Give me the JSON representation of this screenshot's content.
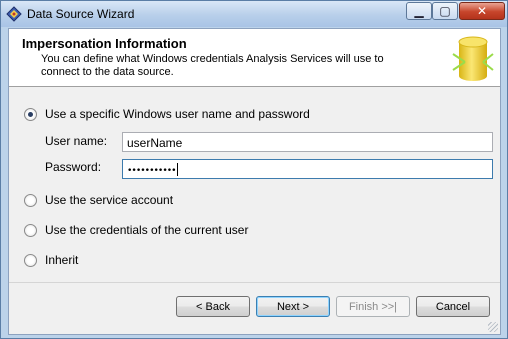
{
  "window": {
    "title": "Data Source Wizard",
    "icon": "wizard-diamond-icon",
    "controls": {
      "minimize": "▁",
      "maximize": "▢",
      "close": "✕"
    }
  },
  "header": {
    "title": "Impersonation Information",
    "description": "You can define what Windows credentials Analysis Services will use to connect to the data source.",
    "icon": "database-cylinder-icon"
  },
  "options": {
    "specific": {
      "label": "Use a specific Windows user name and password",
      "checked": true
    },
    "service": {
      "label": "Use the service account",
      "checked": false
    },
    "current": {
      "label": "Use the credentials of the current user",
      "checked": false
    },
    "inherit": {
      "label": "Inherit",
      "checked": false
    }
  },
  "fields": {
    "username": {
      "label": "User name:",
      "value": "userName"
    },
    "password": {
      "label": "Password:",
      "mask": "•••••••••••"
    }
  },
  "buttons": {
    "back": "< Back",
    "next": "Next >",
    "finish": "Finish >>|",
    "cancel": "Cancel"
  },
  "colors": {
    "titlebar": "#b8cfea",
    "close_button": "#c7452b",
    "dialog_bg": "#f0f0f0",
    "cylinder": "#f2d234"
  }
}
